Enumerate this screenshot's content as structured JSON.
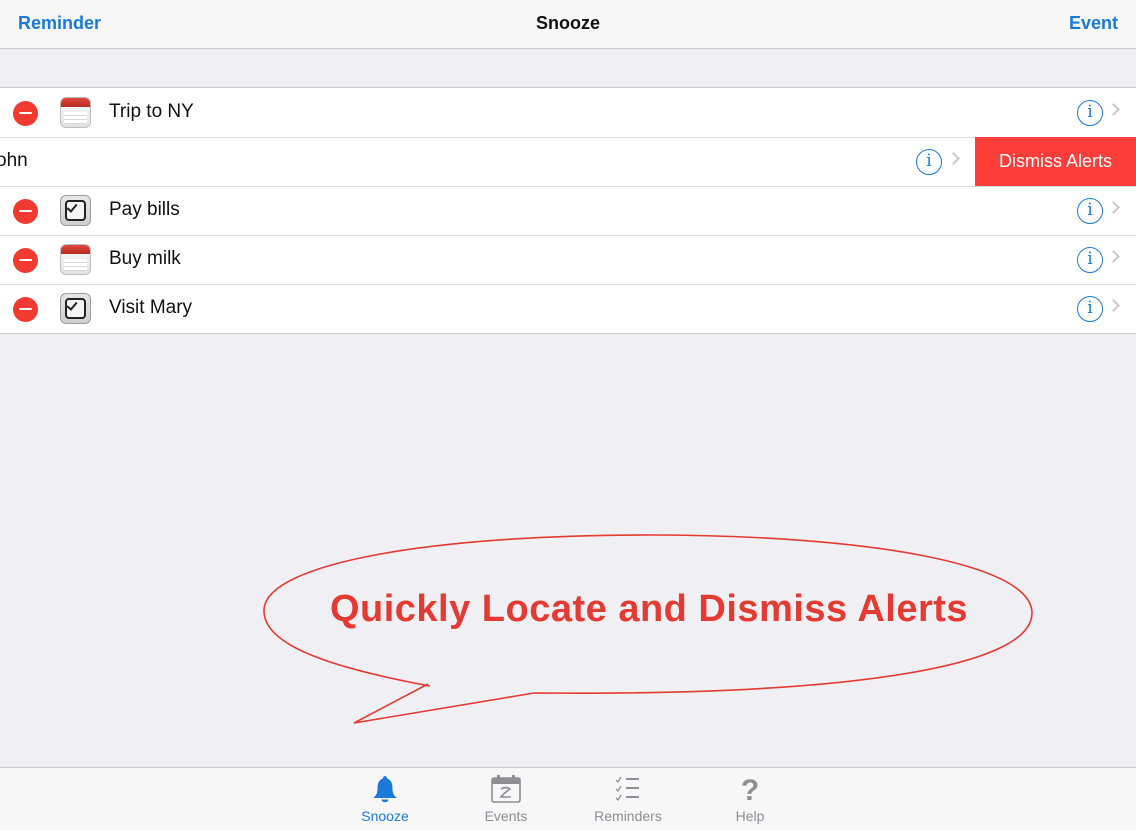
{
  "navbar": {
    "left_label": "Reminder",
    "title": "Snooze",
    "right_label": "Event"
  },
  "rows": [
    {
      "label": "Trip to NY",
      "icon": "calendar-icon"
    },
    {
      "label": "ohn",
      "icon": "none",
      "action": "Dismiss Alerts"
    },
    {
      "label": "Pay bills",
      "icon": "reminder-clock-icon"
    },
    {
      "label": "Buy milk",
      "icon": "calendar-icon"
    },
    {
      "label": "Visit Mary",
      "icon": "reminder-clock-icon"
    }
  ],
  "info_glyph": "i",
  "callout": {
    "text": "Quickly Locate and Dismiss Alerts"
  },
  "tabbar": {
    "tabs": [
      {
        "label": "Snooze",
        "icon": "bell-icon",
        "active": true
      },
      {
        "label": "Events",
        "icon": "calendar-icon",
        "active": false
      },
      {
        "label": "Reminders",
        "icon": "list-icon",
        "active": false
      },
      {
        "label": "Help",
        "icon": "question-icon",
        "active": false
      }
    ]
  },
  "colors": {
    "accent": "#1a7ad9",
    "delete": "#f23a30",
    "dismiss": "#fc3d39",
    "callout": "#e53a32"
  }
}
